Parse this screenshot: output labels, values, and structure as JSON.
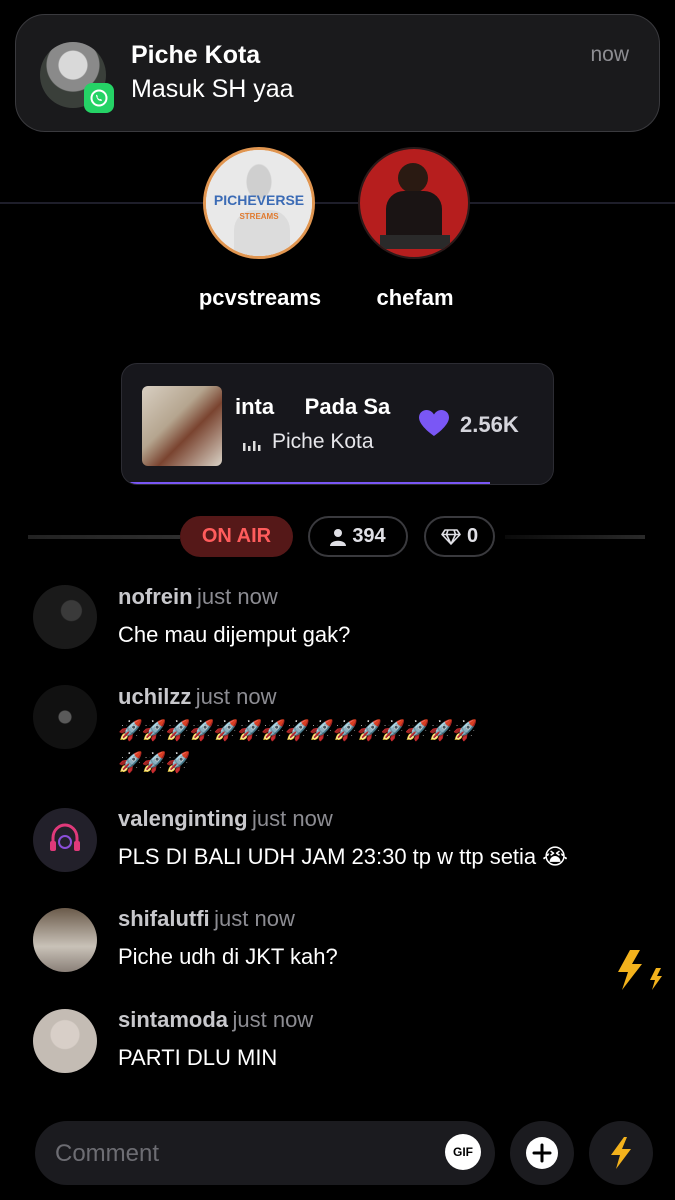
{
  "notification": {
    "title": "Piche Kota",
    "message": "Masuk SH yaa",
    "time": "now",
    "app_icon": "whatsapp-icon"
  },
  "stories": [
    {
      "name": "pcvstreams",
      "logo_text": "PICHEVERSE",
      "logo_sub": "STREAMS"
    },
    {
      "name": "chefam"
    }
  ],
  "now_playing": {
    "title": "inta     Pada Sa",
    "artist": "Piche Kota",
    "likes": "2.56K",
    "progress": 0.85,
    "accent": "#7a57f5"
  },
  "status": {
    "on_air": "ON AIR",
    "viewers": "394",
    "gems": "0"
  },
  "chat": [
    {
      "user": "nofrein",
      "time": "just now",
      "text": "Che mau dijemput gak?"
    },
    {
      "user": "uchilzz",
      "time": "just now",
      "text": "🚀🚀🚀🚀🚀🚀🚀🚀🚀🚀🚀🚀🚀🚀🚀",
      "text2": "🚀🚀🚀"
    },
    {
      "user": "valenginting",
      "time": "just now",
      "text": "PLS DI BALI UDH JAM 23:30 tp w ttp setia 😭"
    },
    {
      "user": "shifalutfi",
      "time": "just now",
      "text": "Piche udh di JKT kah?"
    },
    {
      "user": "sintamoda",
      "time": "just now",
      "text": "PARTI DLU MIN"
    }
  ],
  "composer": {
    "placeholder": "Comment",
    "gif_label": "GIF"
  },
  "colors": {
    "on_air_bg": "#551818",
    "on_air_text": "#ff5c5c",
    "heart": "#7a57f5"
  }
}
